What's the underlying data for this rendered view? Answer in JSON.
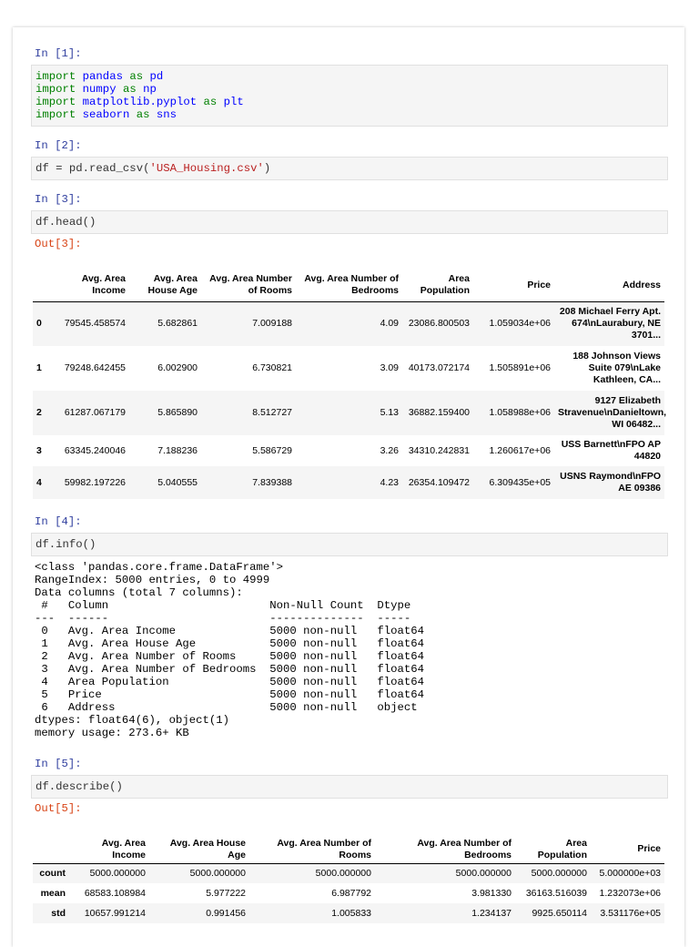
{
  "cells": {
    "c1": {
      "prompt": "In [1]:",
      "lines": [
        [
          {
            "t": "import",
            "c": "kw"
          },
          {
            "t": " ",
            "c": "plain"
          },
          {
            "t": "pandas",
            "c": "nm"
          },
          {
            "t": " ",
            "c": "plain"
          },
          {
            "t": "as",
            "c": "kw"
          },
          {
            "t": " ",
            "c": "plain"
          },
          {
            "t": "pd",
            "c": "nm"
          }
        ],
        [
          {
            "t": "import",
            "c": "kw"
          },
          {
            "t": " ",
            "c": "plain"
          },
          {
            "t": "numpy",
            "c": "nm"
          },
          {
            "t": " ",
            "c": "plain"
          },
          {
            "t": "as",
            "c": "kw"
          },
          {
            "t": " ",
            "c": "plain"
          },
          {
            "t": "np",
            "c": "nm"
          }
        ],
        [
          {
            "t": "import",
            "c": "kw"
          },
          {
            "t": " ",
            "c": "plain"
          },
          {
            "t": "matplotlib.pyplot",
            "c": "nm"
          },
          {
            "t": " ",
            "c": "plain"
          },
          {
            "t": "as",
            "c": "kw"
          },
          {
            "t": " ",
            "c": "plain"
          },
          {
            "t": "plt",
            "c": "nm"
          }
        ],
        [
          {
            "t": "import",
            "c": "kw"
          },
          {
            "t": " ",
            "c": "plain"
          },
          {
            "t": "seaborn",
            "c": "nm"
          },
          {
            "t": " ",
            "c": "plain"
          },
          {
            "t": "as",
            "c": "kw"
          },
          {
            "t": " ",
            "c": "plain"
          },
          {
            "t": "sns",
            "c": "nm"
          }
        ]
      ]
    },
    "c2": {
      "prompt": "In [2]:",
      "lines": [
        [
          {
            "t": "df = pd.read_csv(",
            "c": "plain"
          },
          {
            "t": "'USA_Housing.csv'",
            "c": "str"
          },
          {
            "t": ")",
            "c": "plain"
          }
        ]
      ]
    },
    "c3": {
      "prompt": "In [3]:",
      "code": "df.head()",
      "out_prompt": "Out[3]:"
    },
    "c4": {
      "prompt": "In [4]:",
      "code": "df.info()"
    },
    "c5": {
      "prompt": "In [5]:",
      "code": "df.describe()",
      "out_prompt": "Out[5]:"
    }
  },
  "head_table": {
    "columns": [
      "",
      "Avg. Area Income",
      "Avg. Area House Age",
      "Avg. Area Number of Rooms",
      "Avg. Area Number of Bedrooms",
      "Area Population",
      "Price",
      "Address"
    ],
    "rows": [
      [
        "0",
        "79545.458574",
        "5.682861",
        "7.009188",
        "4.09",
        "23086.800503",
        "1.059034e+06",
        "208 Michael Ferry Apt. 674\\nLaurabury, NE 3701..."
      ],
      [
        "1",
        "79248.642455",
        "6.002900",
        "6.730821",
        "3.09",
        "40173.072174",
        "1.505891e+06",
        "188 Johnson Views Suite 079\\nLake Kathleen, CA..."
      ],
      [
        "2",
        "61287.067179",
        "5.865890",
        "8.512727",
        "5.13",
        "36882.159400",
        "1.058988e+06",
        "9127 Elizabeth Stravenue\\nDanieltown, WI 06482..."
      ],
      [
        "3",
        "63345.240046",
        "7.188236",
        "5.586729",
        "3.26",
        "34310.242831",
        "1.260617e+06",
        "USS Barnett\\nFPO AP 44820"
      ],
      [
        "4",
        "59982.197226",
        "5.040555",
        "7.839388",
        "4.23",
        "26354.109472",
        "6.309435e+05",
        "USNS Raymond\\nFPO AE 09386"
      ]
    ]
  },
  "info_output": [
    "<class 'pandas.core.frame.DataFrame'>",
    "RangeIndex: 5000 entries, 0 to 4999",
    "Data columns (total 7 columns):",
    " #   Column                        Non-Null Count  Dtype  ",
    "---  ------                        --------------  -----  ",
    " 0   Avg. Area Income              5000 non-null   float64",
    " 1   Avg. Area House Age           5000 non-null   float64",
    " 2   Avg. Area Number of Rooms     5000 non-null   float64",
    " 3   Avg. Area Number of Bedrooms  5000 non-null   float64",
    " 4   Area Population               5000 non-null   float64",
    " 5   Price                         5000 non-null   float64",
    " 6   Address                       5000 non-null   object ",
    "dtypes: float64(6), object(1)",
    "memory usage: 273.6+ KB"
  ],
  "describe_table": {
    "columns": [
      "",
      "Avg. Area Income",
      "Avg. Area House Age",
      "Avg. Area Number of Rooms",
      "Avg. Area Number of Bedrooms",
      "Area Population",
      "Price"
    ],
    "rows": [
      [
        "count",
        "5000.000000",
        "5000.000000",
        "5000.000000",
        "5000.000000",
        "5000.000000",
        "5.000000e+03"
      ],
      [
        "mean",
        "68583.108984",
        "5.977222",
        "6.987792",
        "3.981330",
        "36163.516039",
        "1.232073e+06"
      ],
      [
        "std",
        "10657.991214",
        "0.991456",
        "1.005833",
        "1.234137",
        "9925.650114",
        "3.531176e+05"
      ]
    ]
  }
}
